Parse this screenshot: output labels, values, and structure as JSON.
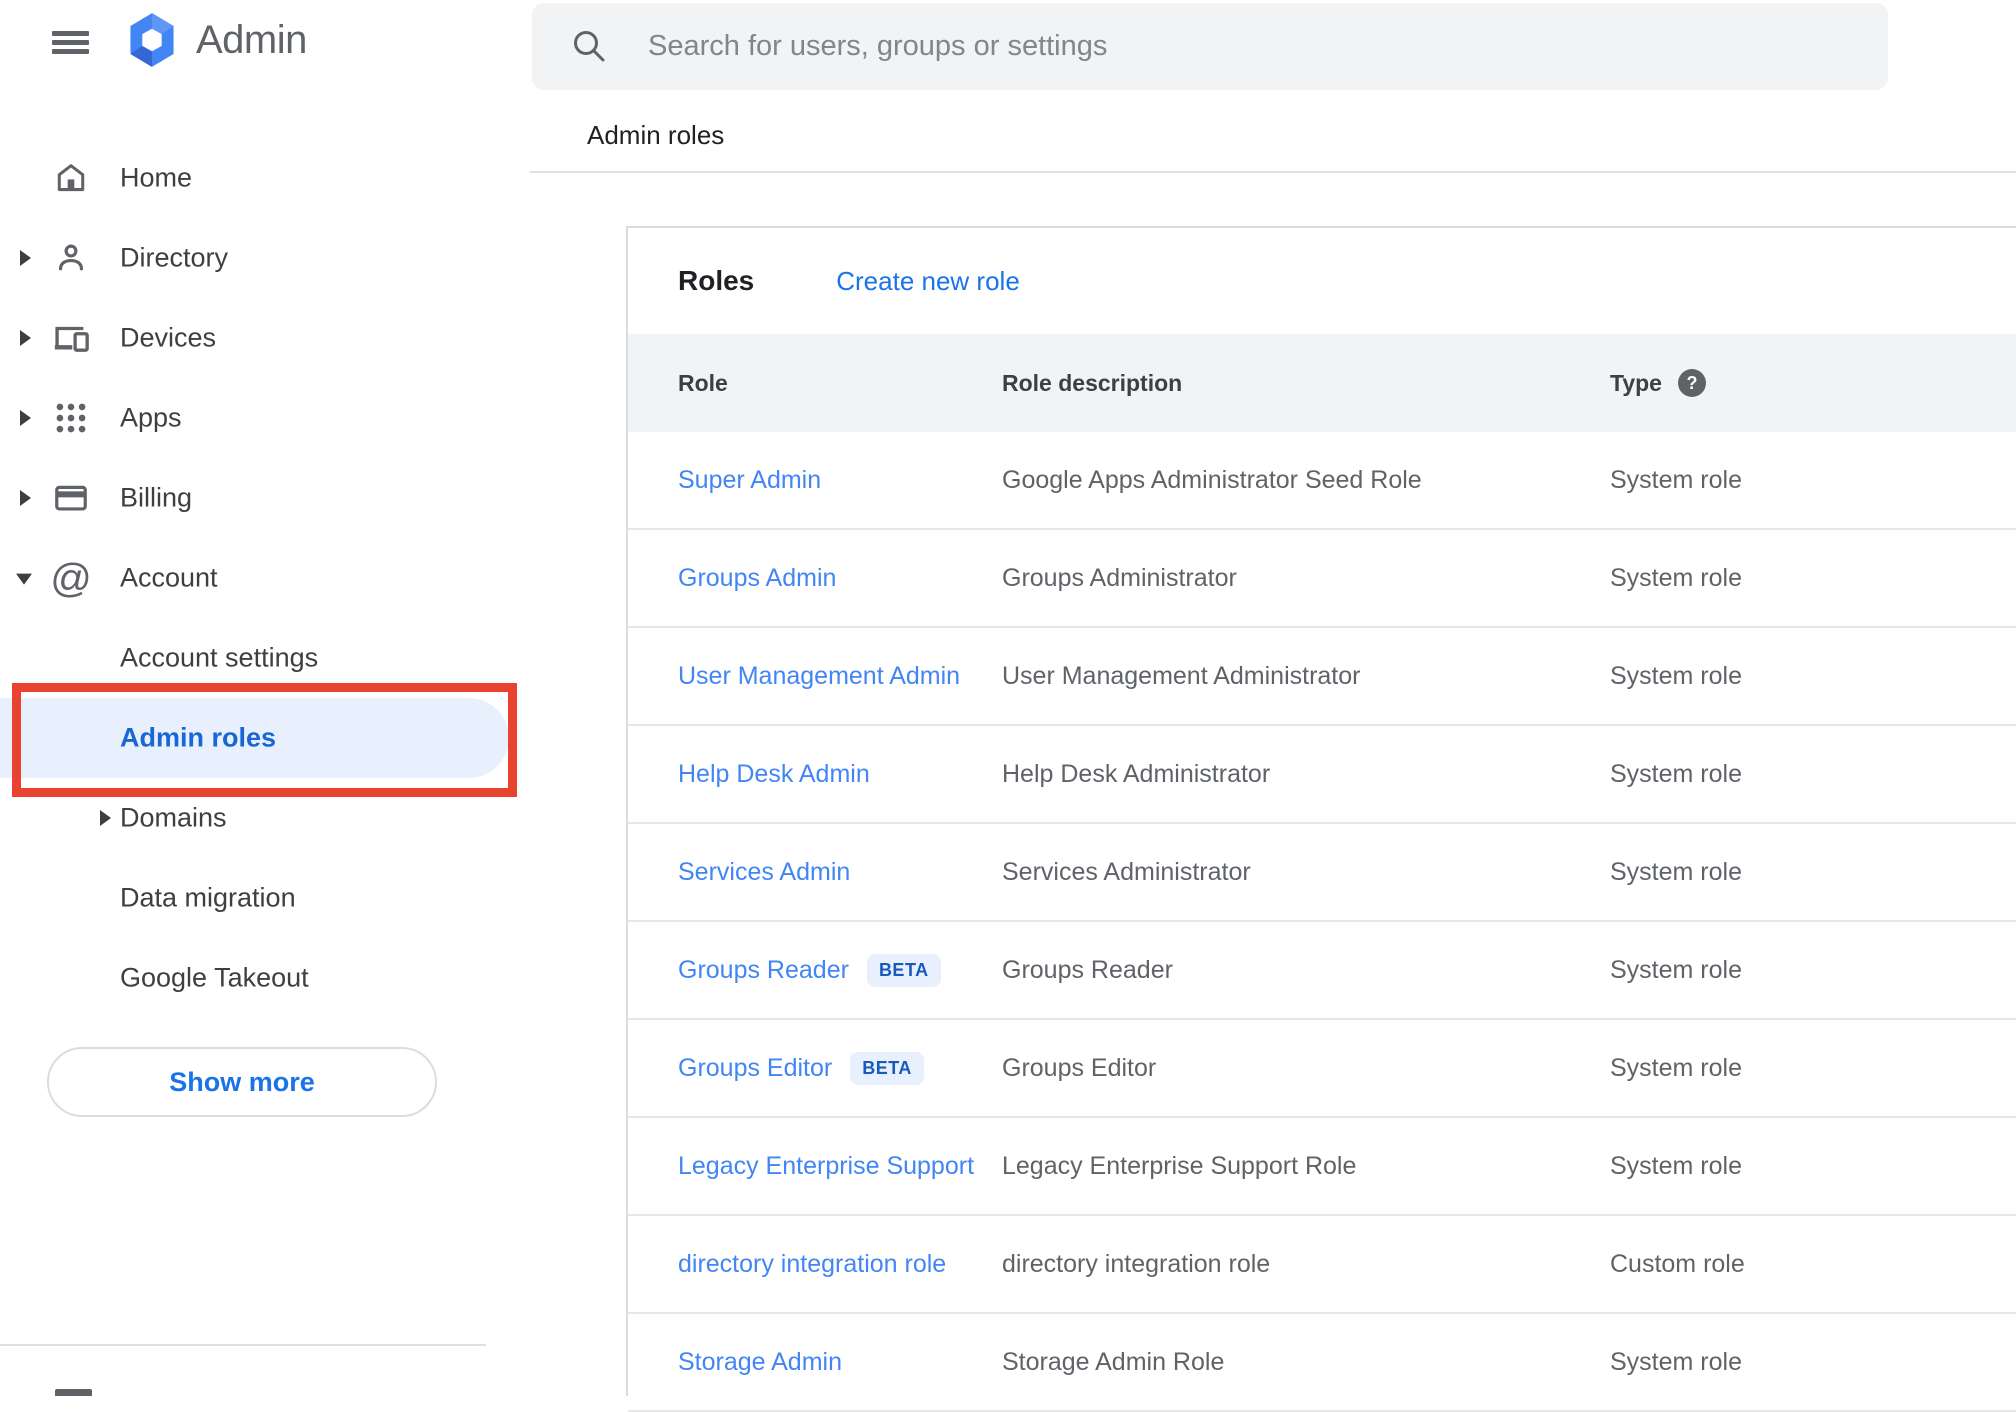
{
  "colors": {
    "accent_blue": "#1a73e8",
    "link_blue": "#4285f4",
    "sidebar_selected_text": "#1967d2",
    "sidebar_selected_bg": "#e8f0fe",
    "annotation_red": "#e8432e",
    "beta_text": "#185abc",
    "beta_bg": "#e8f0fe",
    "table_header_bg": "#f1f3f4"
  },
  "topbar": {
    "product_name": "Admin",
    "search": {
      "placeholder": "Search for users, groups or settings"
    }
  },
  "breadcrumb": {
    "label": "Admin roles"
  },
  "sidebar": {
    "items": [
      {
        "label": "Home",
        "icon": "home-icon"
      },
      {
        "label": "Directory",
        "icon": "person-icon",
        "arrow": "right"
      },
      {
        "label": "Devices",
        "icon": "devices-icon",
        "arrow": "right"
      },
      {
        "label": "Apps",
        "icon": "apps-icon",
        "arrow": "right"
      },
      {
        "label": "Billing",
        "icon": "billing-icon",
        "arrow": "right"
      },
      {
        "label": "Account",
        "icon": "at-icon",
        "arrow": "down"
      },
      {
        "label": "Account settings",
        "sub": true
      },
      {
        "label": "Admin roles",
        "sub": true,
        "selected": true,
        "highlighted": true
      },
      {
        "label": "Domains",
        "sub": true,
        "arrow": "right"
      },
      {
        "label": "Data migration",
        "sub": true
      },
      {
        "label": "Google Takeout",
        "sub": true
      }
    ],
    "show_more_label": "Show more"
  },
  "main": {
    "title": "Roles",
    "create_link": "Create new role",
    "table": {
      "columns": [
        "Role",
        "Role description",
        "Type"
      ],
      "beta_badge_label": "BETA",
      "rows": [
        {
          "role": "Super Admin",
          "description": "Google Apps Administrator Seed Role",
          "type": "System role"
        },
        {
          "role": "Groups Admin",
          "description": "Groups Administrator",
          "type": "System role"
        },
        {
          "role": "User Management Admin",
          "description": "User Management Administrator",
          "type": "System role"
        },
        {
          "role": "Help Desk Admin",
          "description": "Help Desk Administrator",
          "type": "System role"
        },
        {
          "role": "Services Admin",
          "description": "Services Administrator",
          "type": "System role"
        },
        {
          "role": "Groups Reader",
          "beta": true,
          "description": "Groups Reader",
          "type": "System role"
        },
        {
          "role": "Groups Editor",
          "beta": true,
          "description": "Groups Editor",
          "type": "System role"
        },
        {
          "role": "Legacy Enterprise Support",
          "description": "Legacy Enterprise Support Role",
          "type": "System role"
        },
        {
          "role": "directory integration role",
          "description": "directory integration role",
          "type": "Custom role"
        },
        {
          "role": "Storage Admin",
          "description": "Storage Admin Role",
          "type": "System role"
        }
      ]
    }
  }
}
